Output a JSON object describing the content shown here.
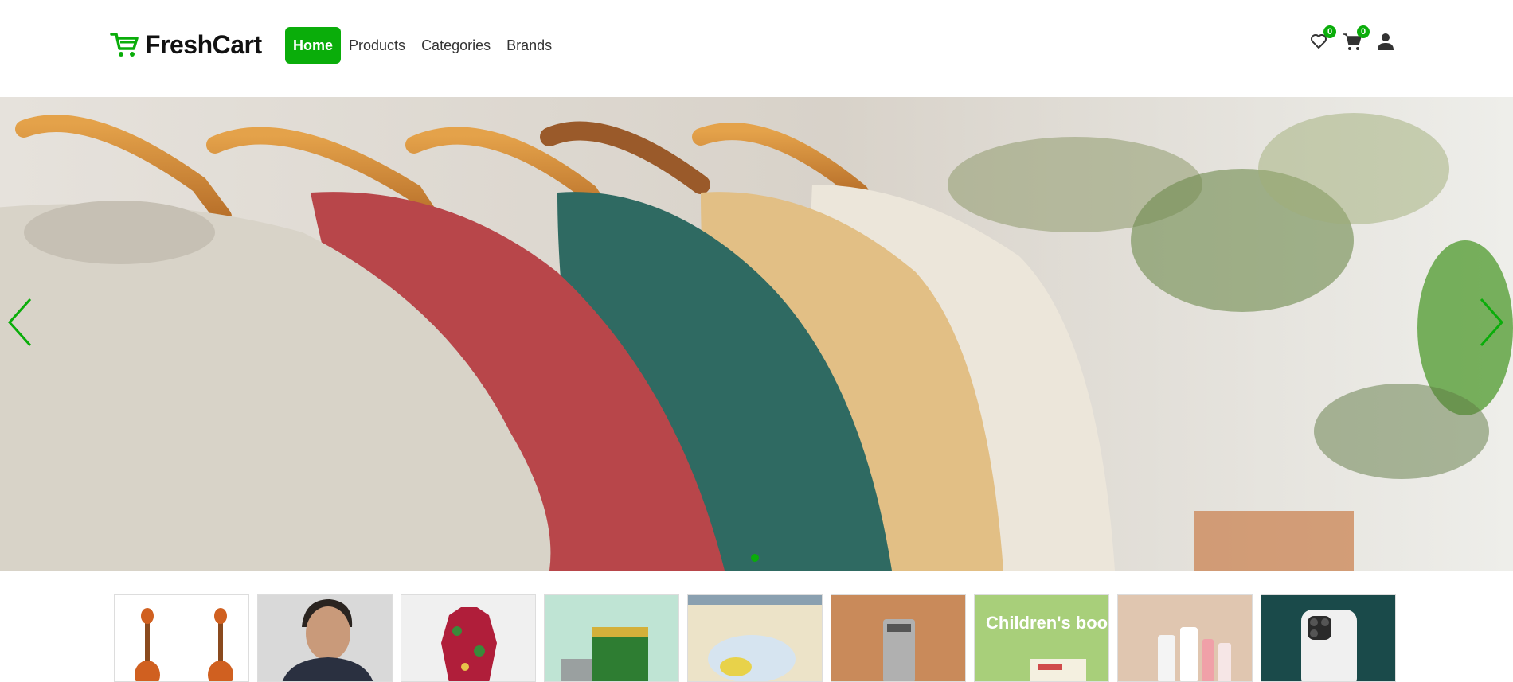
{
  "app": {
    "brand": "FreshCart",
    "accent": "#0aad0a"
  },
  "nav": {
    "links": [
      {
        "label": "Home",
        "active": true
      },
      {
        "label": "Products",
        "active": false
      },
      {
        "label": "Categories",
        "active": false
      },
      {
        "label": "Brands",
        "active": false
      }
    ],
    "wishlist_count": "0",
    "cart_count": "0",
    "icons": [
      "heart-icon",
      "cart-icon",
      "user-icon"
    ]
  },
  "slider": {
    "image": "sweaters-on-hangers",
    "active_slide": 1,
    "total_slides": 1
  },
  "categories": [
    {
      "name": "music-instruments"
    },
    {
      "name": "men-fashion"
    },
    {
      "name": "women-fashion"
    },
    {
      "name": "supermarket"
    },
    {
      "name": "baby-and-toys"
    },
    {
      "name": "home"
    },
    {
      "name": "books",
      "label": "Children's books"
    },
    {
      "name": "beauty-and-health"
    },
    {
      "name": "mobiles"
    }
  ]
}
